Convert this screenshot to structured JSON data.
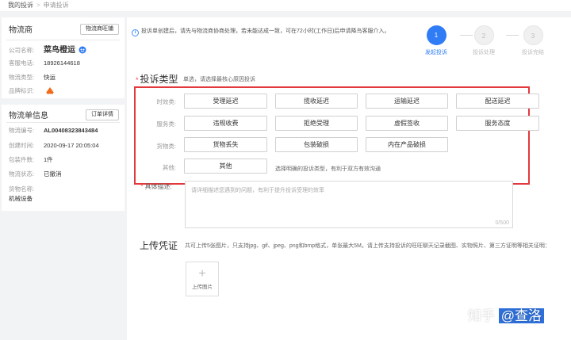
{
  "breadcrumb": {
    "home": "我的投诉",
    "sep": ">",
    "current": "申请投诉"
  },
  "carrier": {
    "title": "物流商",
    "button": "物流商旺铺",
    "company_label": "公司名称:",
    "company_value": "菜鸟橙运",
    "phone_label": "客服电话:",
    "phone_value": "18926144618",
    "type_label": "物流类型:",
    "type_value": "快运",
    "brand_label": "品牌标识:"
  },
  "order": {
    "title": "物流单信息",
    "button": "订单详情",
    "number_label": "物流编号:",
    "number_value": "AL00408323843484",
    "created_label": "创建时间:",
    "created_value": "2020-09-17 20:05:04",
    "count_label": "包装件数:",
    "count_value": "1件",
    "status_label": "物流状态:",
    "status_value": "已撤消",
    "goods_label": "货物名称:",
    "goods_value": "机械设备"
  },
  "notice": "投诉单创建后，请先与物流商协商处理，若未能达成一致，可在72小时(工作日)后申请降鸟客服介入。",
  "steps": [
    {
      "num": "1",
      "label": "发起投诉"
    },
    {
      "num": "2",
      "label": "投诉处理"
    },
    {
      "num": "3",
      "label": "投诉完结"
    }
  ],
  "complaint_type": {
    "required": "*",
    "title": "投诉类型",
    "hint": "单选，请选择最核心原因投诉",
    "rows": [
      {
        "label": "时效类:",
        "options": [
          "受理延迟",
          "揽收延迟",
          "运输延迟",
          "配送延迟"
        ]
      },
      {
        "label": "服务类:",
        "options": [
          "违规收费",
          "拒绝受理",
          "虚假签收",
          "服务态度"
        ]
      },
      {
        "label": "货物类:",
        "options": [
          "货物丢失",
          "包装破损",
          "内在产品破损"
        ]
      },
      {
        "label": "其他:",
        "options": [
          "其他"
        ]
      }
    ],
    "other_hint": "选择明确的投诉类型，有利于双方有效沟通"
  },
  "description": {
    "required": "*",
    "label": "具体描述:",
    "placeholder": "请详细描述您遇到的问题，有利于提升投诉受理的效率",
    "counter": "0/500"
  },
  "upload": {
    "title": "上传凭证",
    "hint": "共可上传5张图片，只支持jpg、gif、jpeg、png和bmp格式，单张最大5M。请上传支持投诉的旺旺聊天记录截图、实物照片、第三方证明等相关证明：",
    "button": "上传图片",
    "plus": "+"
  },
  "watermark": {
    "text1": "知乎",
    "text2": "@查洛"
  },
  "colors": {
    "accent": "#2f7cf6",
    "highlight_border": "#e2393f",
    "required": "#f04848"
  },
  "icons": {
    "info": "info-icon",
    "brand": "brand-logo-icon",
    "upload": "plus-icon"
  }
}
